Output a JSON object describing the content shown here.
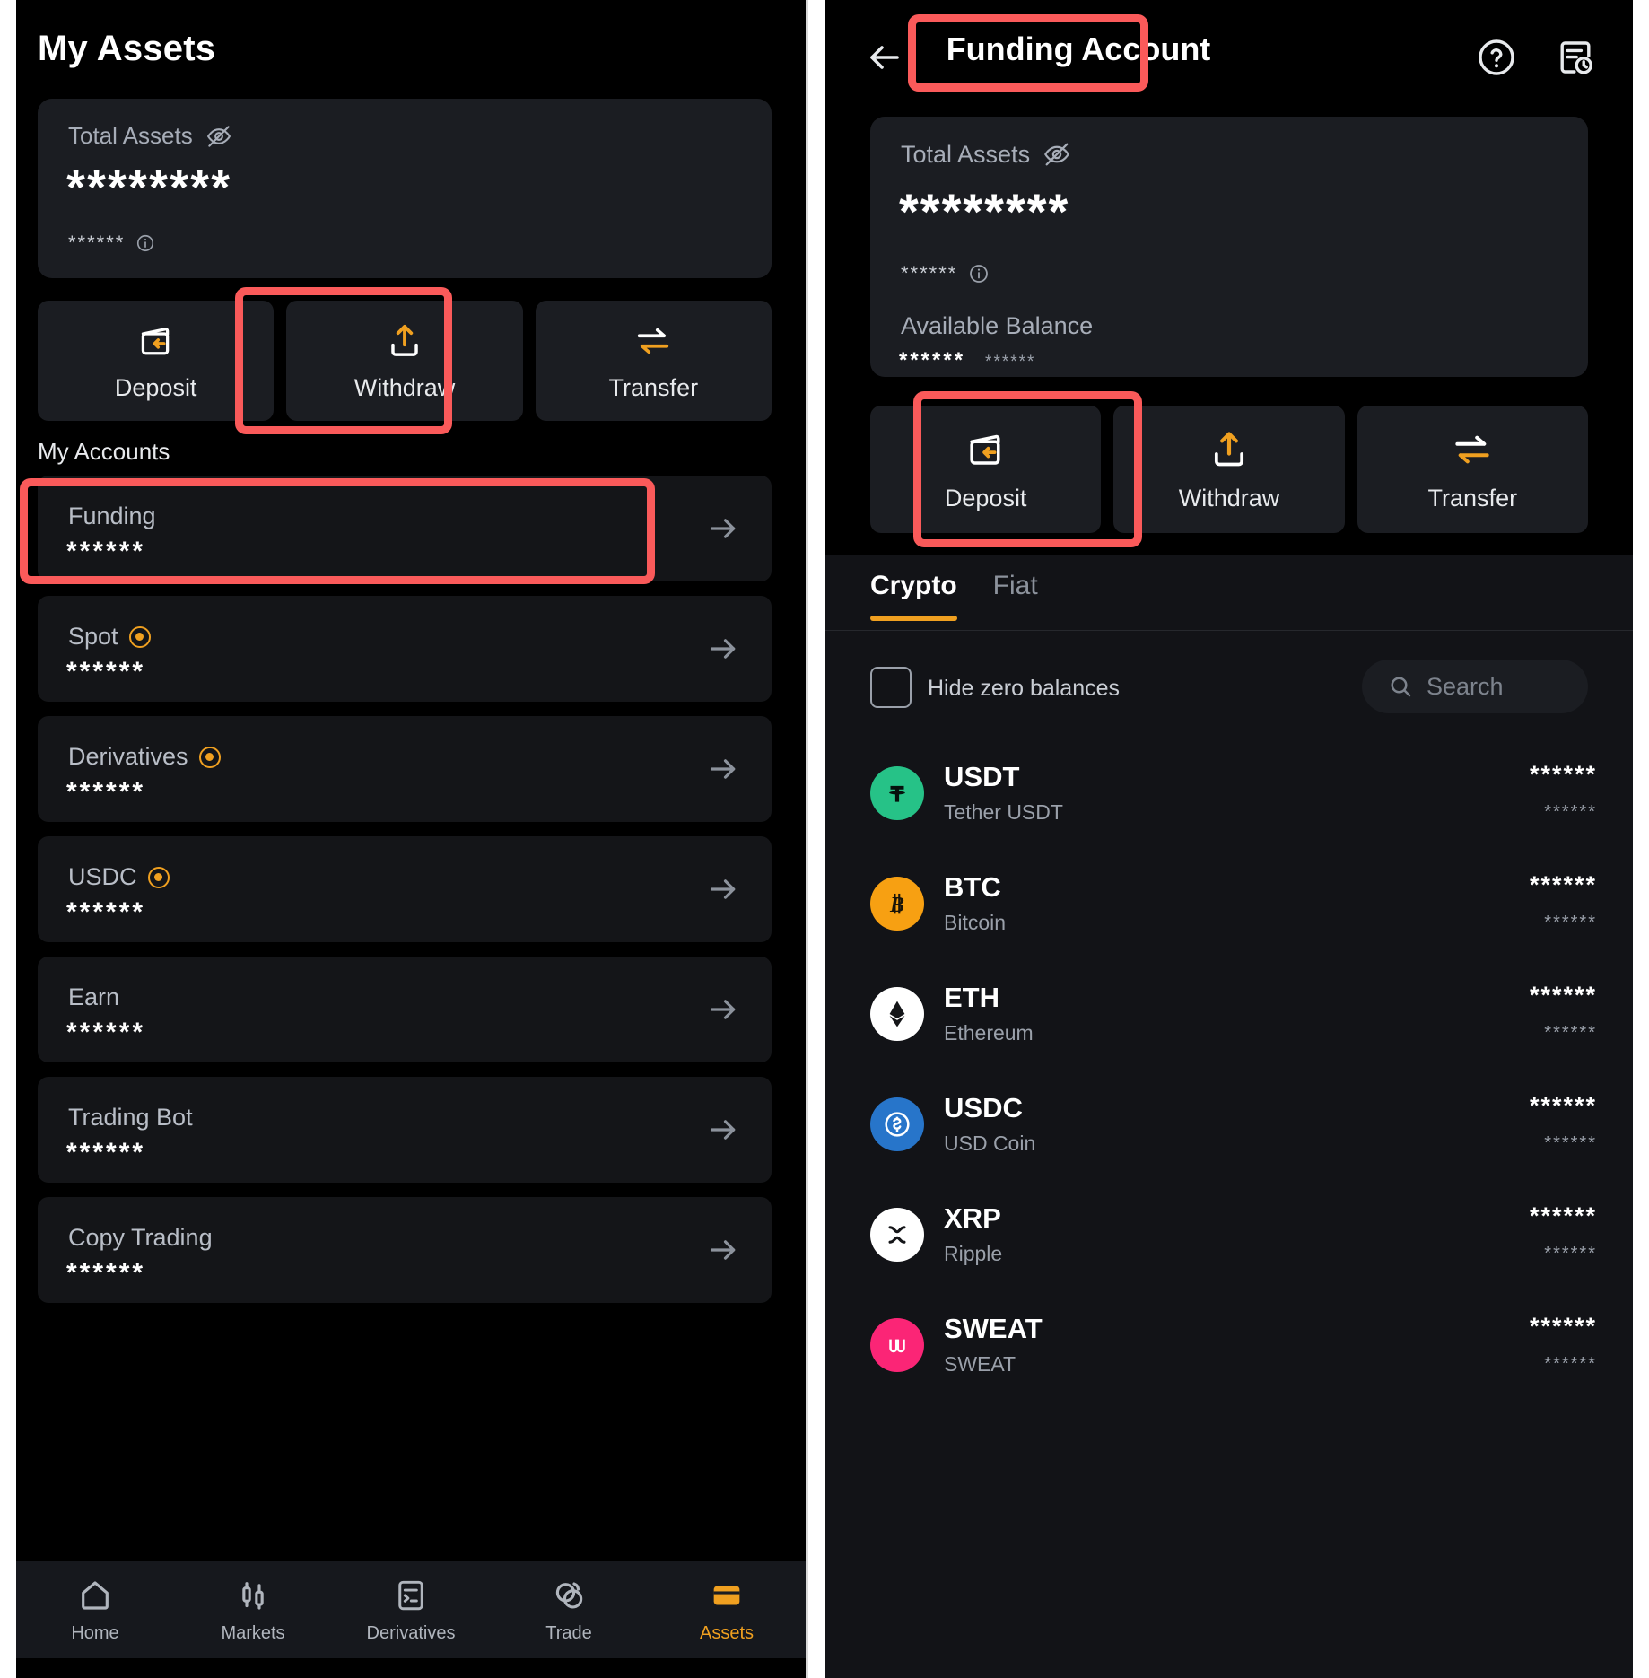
{
  "left_screen": {
    "page_title": "My Assets",
    "total_card": {
      "label": "Total Assets",
      "eye_icon": "eye-off-icon",
      "amount": "********",
      "sub_value": "******",
      "info_icon": "info-icon"
    },
    "actions": [
      {
        "id": "deposit",
        "label": "Deposit",
        "icon": "deposit-icon"
      },
      {
        "id": "withdraw",
        "label": "Withdraw",
        "icon": "withdraw-icon"
      },
      {
        "id": "transfer",
        "label": "Transfer",
        "icon": "transfer-icon"
      }
    ],
    "accounts_section_label": "My Accounts",
    "accounts": [
      {
        "name": "Funding",
        "value": "******",
        "badge": false,
        "arrow": "arrow-right-icon"
      },
      {
        "name": "Spot",
        "value": "******",
        "badge": true,
        "arrow": "arrow-right-icon"
      },
      {
        "name": "Derivatives",
        "value": "******",
        "badge": true,
        "arrow": "arrow-right-icon"
      },
      {
        "name": "USDC",
        "value": "******",
        "badge": true,
        "arrow": "arrow-right-icon"
      },
      {
        "name": "Earn",
        "value": "******",
        "badge": false,
        "arrow": "arrow-right-icon"
      },
      {
        "name": "Trading Bot",
        "value": "******",
        "badge": false,
        "arrow": "arrow-right-icon"
      },
      {
        "name": "Copy Trading",
        "value": "******",
        "badge": false,
        "arrow": "arrow-right-icon"
      }
    ],
    "bottom_nav": [
      {
        "label": "Home",
        "icon": "home-icon",
        "active": false
      },
      {
        "label": "Markets",
        "icon": "candlestick-icon",
        "active": false
      },
      {
        "label": "Derivatives",
        "icon": "document-list-icon",
        "active": false
      },
      {
        "label": "Trade",
        "icon": "trade-circles-icon",
        "active": false
      },
      {
        "label": "Assets",
        "icon": "wallet-icon",
        "active": true
      }
    ]
  },
  "right_screen": {
    "header": {
      "back_icon": "arrow-left-icon",
      "title": "Funding Account",
      "help_icon": "question-circle-icon",
      "history_icon": "order-history-icon"
    },
    "total_card": {
      "label": "Total Assets",
      "eye_icon": "eye-off-icon",
      "amount": "********",
      "sub_value": "******",
      "info_icon": "info-icon",
      "available_label": "Available Balance",
      "available_value": "******",
      "available_fiat": "******"
    },
    "actions": [
      {
        "id": "deposit",
        "label": "Deposit",
        "icon": "deposit-icon"
      },
      {
        "id": "withdraw",
        "label": "Withdraw",
        "icon": "withdraw-icon"
      },
      {
        "id": "transfer",
        "label": "Transfer",
        "icon": "transfer-icon"
      }
    ],
    "tabs": [
      {
        "label": "Crypto",
        "active": true
      },
      {
        "label": "Fiat",
        "active": false
      }
    ],
    "filter": {
      "hide_zero_label": "Hide zero balances",
      "hide_zero_checked": false,
      "search_placeholder": "Search",
      "search_icon": "search-icon"
    },
    "coins": [
      {
        "symbol": "USDT",
        "name": "Tether USDT",
        "amount": "******",
        "fiat": "******",
        "icon": "usdt-icon",
        "color": "#26c287",
        "glyph": "₮"
      },
      {
        "symbol": "BTC",
        "name": "Bitcoin",
        "amount": "******",
        "fiat": "******",
        "icon": "btc-icon",
        "color": "#f7a012",
        "glyph": "฿"
      },
      {
        "symbol": "ETH",
        "name": "Ethereum",
        "amount": "******",
        "fiat": "******",
        "icon": "eth-icon",
        "color": "#ffffff",
        "glyph": "◆"
      },
      {
        "symbol": "USDC",
        "name": "USD Coin",
        "amount": "******",
        "fiat": "******",
        "icon": "usdc-icon",
        "color": "#2775ca",
        "glyph": "$"
      },
      {
        "symbol": "XRP",
        "name": "Ripple",
        "amount": "******",
        "fiat": "******",
        "icon": "xrp-icon",
        "color": "#ffffff",
        "glyph": "✕"
      },
      {
        "symbol": "SWEAT",
        "name": "SWEAT",
        "amount": "******",
        "fiat": "******",
        "icon": "sweat-icon",
        "color": "#fb2576",
        "glyph": "Ш"
      }
    ]
  },
  "annotations": {
    "color": "#fa5a5a",
    "boxes": [
      {
        "target": "withdraw-button-left"
      },
      {
        "target": "funding-account-row"
      },
      {
        "target": "funding-account-title"
      },
      {
        "target": "withdraw-button-right"
      }
    ]
  },
  "theme": {
    "accent": "#f0a020",
    "background": "#000000",
    "card": "#1b1d22",
    "row": "#141518",
    "text_primary": "#ffffff",
    "text_secondary": "#9aa0aa"
  }
}
